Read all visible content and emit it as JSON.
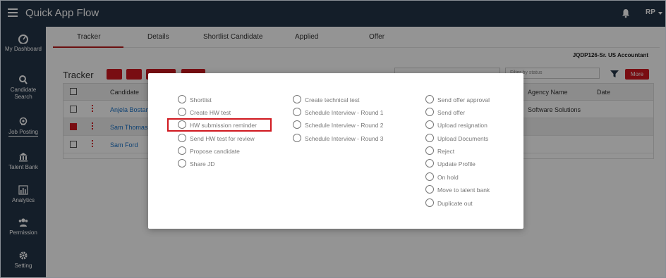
{
  "app": {
    "title": "Quick App Flow",
    "user_initials": "RP"
  },
  "sidebar": {
    "items": [
      {
        "label": "My Dashboard",
        "icon": "dashboard-icon"
      },
      {
        "label": "Candidate Search",
        "icon": "search-icon"
      },
      {
        "label": "Job Posting",
        "icon": "location-pin-icon",
        "active": true
      },
      {
        "label": "Talent Bank",
        "icon": "bank-icon"
      },
      {
        "label": "Analytics",
        "icon": "bar-chart-icon"
      },
      {
        "label": "Permission",
        "icon": "users-icon"
      },
      {
        "label": "Setting",
        "icon": "gear-icon"
      }
    ]
  },
  "tabs": [
    {
      "label": "Tracker",
      "active": true
    },
    {
      "label": "Details"
    },
    {
      "label": "Shortlist Candidate"
    },
    {
      "label": "Applied"
    },
    {
      "label": "Offer"
    }
  ],
  "job_title": "JQDP126-Sr. US Accountant",
  "tracker": {
    "title": "Tracker",
    "status_placeholder": "Filter by status",
    "more_label": "More",
    "columns": {
      "candidate": "Candidate",
      "agency": "Agency Name",
      "date": "Date"
    },
    "rows": [
      {
        "candidate": "Anjela Bostan",
        "agency": "Software Solutions",
        "checked": false
      },
      {
        "candidate": "Sam Thomas",
        "agency": "",
        "checked": true
      },
      {
        "candidate": "Sam Ford",
        "agency": "",
        "checked": false
      }
    ]
  },
  "modal": {
    "col1": [
      "Shortlist",
      "Create HW test",
      "HW submission reminder",
      "Send HW test for review",
      "Propose candidate",
      "Share JD"
    ],
    "col2": [
      "Create technical test",
      "Schedule Interview - Round 1",
      "Schedule Interview - Round 2",
      "Schedule Interview - Round 3"
    ],
    "col3": [
      "Send offer approval",
      "Send offer",
      "Upload resignation",
      "Upload Documents",
      "Reject",
      "Update Profile",
      "On hold",
      "Move to talent bank",
      "Duplicate out"
    ],
    "highlighted": "HW submission reminder"
  },
  "colors": {
    "sidebar_bg": "#243447",
    "accent_red": "#d0181f",
    "link_blue": "#1a73c8"
  }
}
